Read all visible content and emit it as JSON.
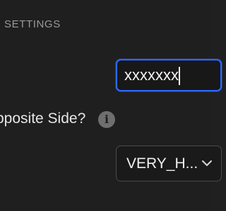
{
  "section": {
    "title": "SETTINGS"
  },
  "text_field": {
    "value": "xxxxxxx"
  },
  "opposite_side": {
    "label": "pposite Side?",
    "info_glyph": "i"
  },
  "dropdown": {
    "selected": "VERY_H..."
  },
  "colors": {
    "background": "#1f1f1f",
    "focus_ring": "#2d6bff",
    "muted_text": "#9a9a9a",
    "icon_fill": "#6f6f6f"
  },
  "icons": {
    "info": "info-icon",
    "dropdown": "chevron-down-icon"
  }
}
